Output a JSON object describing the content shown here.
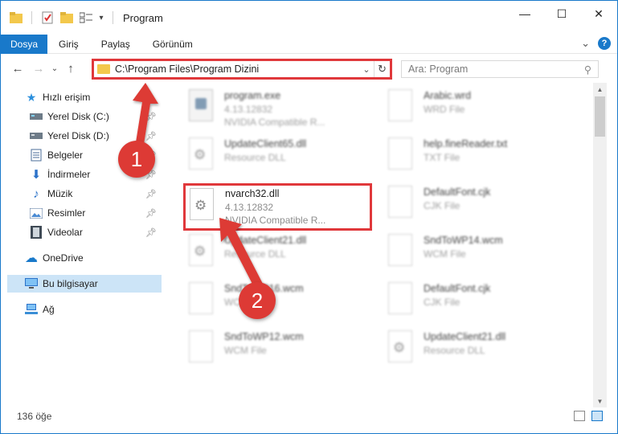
{
  "title_bar": {
    "title": "Program",
    "minimize_glyph": "—",
    "maximize_glyph": "☐",
    "close_glyph": "✕"
  },
  "ribbon": {
    "tabs": [
      "Dosya",
      "Giriş",
      "Paylaş",
      "Görünüm"
    ],
    "collapse_glyph": "⌄",
    "help_glyph": "?"
  },
  "nav": {
    "back_glyph": "←",
    "forward_glyph": "→",
    "recent_glyph": "⌄",
    "up_glyph": "↑",
    "address_path": "C:\\Program Files\\Program Dizini",
    "address_dropdown_glyph": "⌄",
    "refresh_glyph": "↻",
    "search_placeholder": "Ara: Program",
    "search_icon_glyph": "⚲"
  },
  "sidebar": {
    "items": [
      {
        "label": "Hızlı erişim",
        "icon": "star-icon",
        "glyph": "★",
        "color": "#2b8fdd",
        "pinned": false
      },
      {
        "label": "Yerel Disk (C:)",
        "icon": "drive-c-icon",
        "glyph": "▬",
        "color": "#5c6b78",
        "pinned": true
      },
      {
        "label": "Yerel Disk (D:)",
        "icon": "drive-d-icon",
        "glyph": "▬",
        "color": "#5c6b78",
        "pinned": true
      },
      {
        "label": "Belgeler",
        "icon": "documents-icon",
        "glyph": "▤",
        "color": "#4b6e99",
        "pinned": true
      },
      {
        "label": "İndirmeler",
        "icon": "downloads-icon",
        "glyph": "⬇",
        "color": "#2b72c9",
        "pinned": true
      },
      {
        "label": "Müzik",
        "icon": "music-icon",
        "glyph": "♪",
        "color": "#2b72c9",
        "pinned": true
      },
      {
        "label": "Resimler",
        "icon": "pictures-icon",
        "glyph": "▣",
        "color": "#4b6e99",
        "pinned": true
      },
      {
        "label": "Videolar",
        "icon": "videos-icon",
        "glyph": "▦",
        "color": "#3f4a55",
        "pinned": true
      },
      {
        "label": "OneDrive",
        "icon": "onedrive-icon",
        "glyph": "☁",
        "color": "#1979ca",
        "pinned": false
      },
      {
        "label": "Bu bilgisayar",
        "icon": "computer-icon",
        "glyph": "▭",
        "color": "#2b72c9",
        "pinned": false,
        "selected": true
      },
      {
        "label": "Ağ",
        "icon": "network-icon",
        "glyph": "⊞",
        "color": "#2b72c9",
        "pinned": false
      }
    ],
    "pin_glyph": "✎"
  },
  "files": [
    {
      "name": "program.exe",
      "line2": "4.13.12832",
      "line3": "NVIDIA Compatible R...",
      "icon": "exe-icon",
      "blurred": true
    },
    {
      "name": "Arabic.wrd",
      "line2": "WRD File",
      "line3": "",
      "icon": "file-icon",
      "blurred": true
    },
    {
      "name": "UpdateClient65.dll",
      "line2": "Resource DLL",
      "line3": "",
      "icon": "dll-icon",
      "blurred": true
    },
    {
      "name": "help.fineReader.txt",
      "line2": "TXT File",
      "line3": "",
      "icon": "file-icon",
      "blurred": true
    },
    {
      "name": "nvarch32.dll",
      "line2": "4.13.12832",
      "line3": "NVIDIA Compatible R...",
      "icon": "dll-icon",
      "blurred": false
    },
    {
      "name": "DefaultFont.cjk",
      "line2": "CJK File",
      "line3": "",
      "icon": "file-icon",
      "blurred": true
    },
    {
      "name": "UpdateClient21.dll",
      "line2": "Resource DLL",
      "line3": "",
      "icon": "dll-icon",
      "blurred": true
    },
    {
      "name": "SndToWP14.wcm",
      "line2": "WCM File",
      "line3": "",
      "icon": "file-icon",
      "blurred": true
    },
    {
      "name": "SndToWP16.wcm",
      "line2": "WCM File",
      "line3": "",
      "icon": "file-icon",
      "blurred": true
    },
    {
      "name": "DefaultFont.cjk",
      "line2": "CJK File",
      "line3": "",
      "icon": "file-icon",
      "blurred": true
    },
    {
      "name": "SndToWP12.wcm",
      "line2": "WCM File",
      "line3": "",
      "icon": "file-icon",
      "blurred": true
    },
    {
      "name": "UpdateClient21.dll",
      "line2": "Resource DLL",
      "line3": "",
      "icon": "dll-icon",
      "blurred": true
    }
  ],
  "status": {
    "item_count": "136 öğe"
  },
  "annotations": {
    "badge1": "1",
    "badge2": "2",
    "color": "#dd3a35"
  }
}
